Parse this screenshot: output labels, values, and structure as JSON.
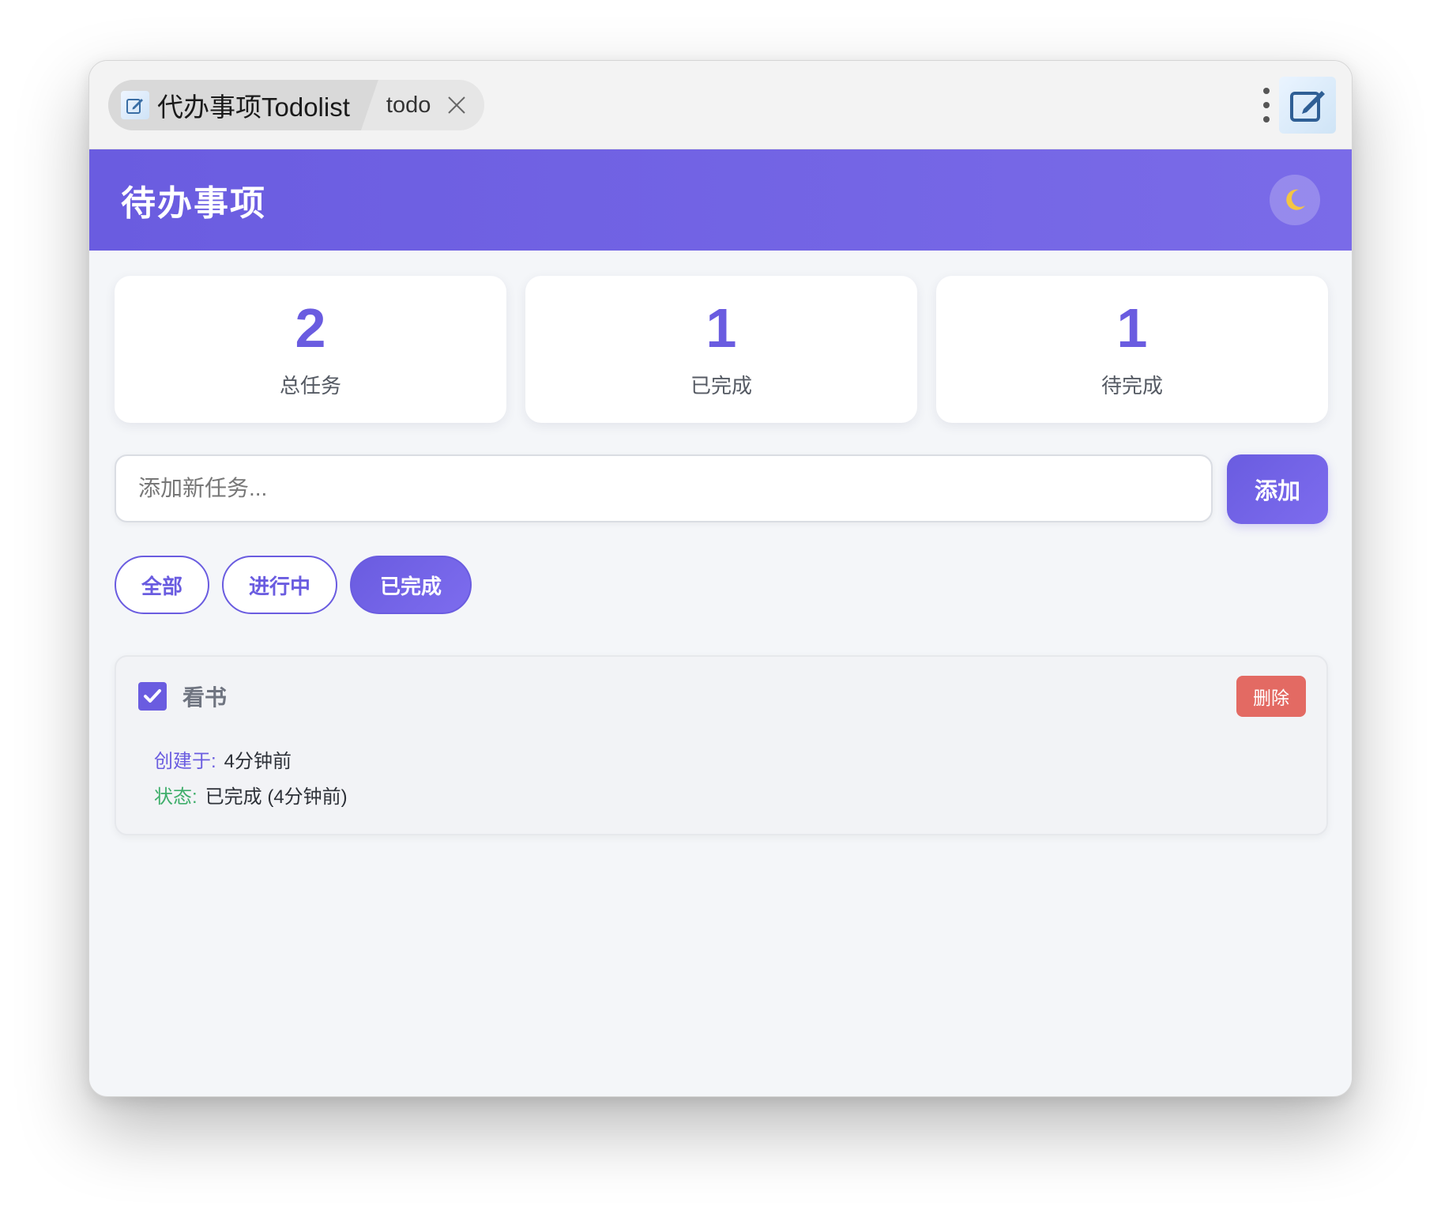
{
  "window": {
    "tab_title": "代办事项Todolist",
    "tab_subtitle": "todo"
  },
  "header": {
    "title": "待办事项",
    "theme_icon": "moon-icon"
  },
  "stats": [
    {
      "value": "2",
      "label": "总任务"
    },
    {
      "value": "1",
      "label": "已完成"
    },
    {
      "value": "1",
      "label": "待完成"
    }
  ],
  "add_task": {
    "placeholder": "添加新任务...",
    "value": "",
    "button_label": "添加"
  },
  "filters": [
    {
      "label": "全部",
      "active": false
    },
    {
      "label": "进行中",
      "active": false
    },
    {
      "label": "已完成",
      "active": true
    }
  ],
  "tasks": [
    {
      "name": "看书",
      "completed": true,
      "delete_label": "删除",
      "created_key": "创建于:",
      "created_value": "4分钟前",
      "status_key": "状态:",
      "status_value": "已完成 (4分钟前)"
    }
  ],
  "colors": {
    "accent": "#6a5ce0",
    "delete": "#e36a63",
    "status_key": "#3fae6b"
  }
}
